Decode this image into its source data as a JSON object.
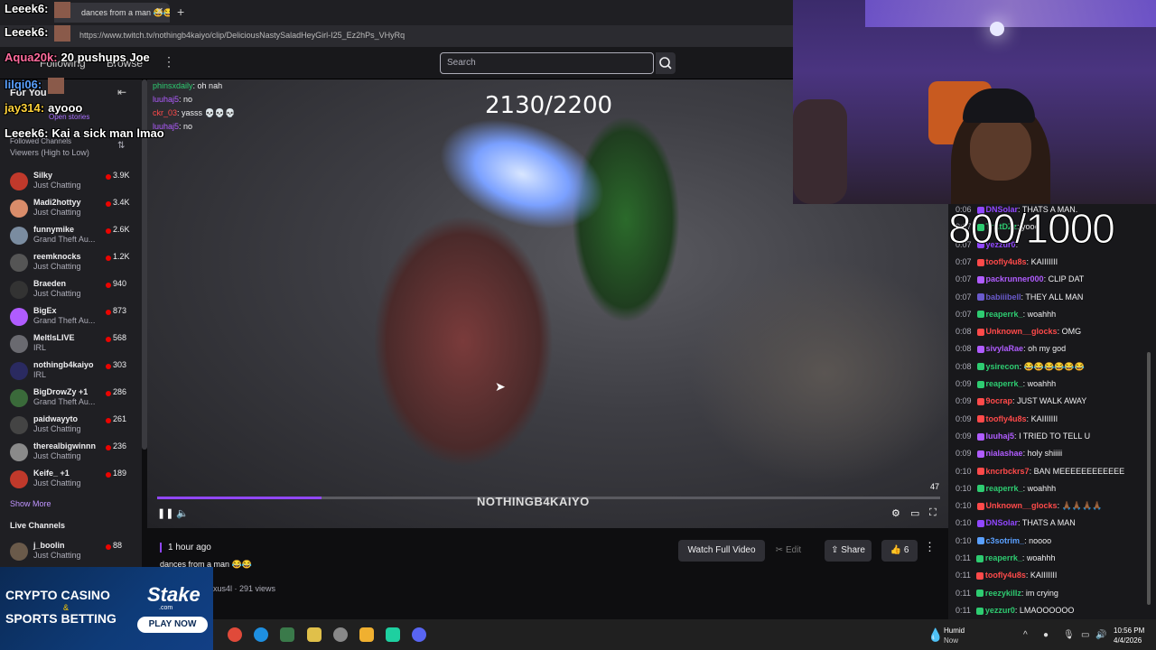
{
  "browser": {
    "tab_title": "dances from a man 😂😂",
    "url": "https://www.twitch.tv/nothingb4kaiyo/clip/DeliciousNastySaladHeyGirl-I25_Ez2hPs_VHyRq"
  },
  "nav": {
    "following": "Following",
    "browse": "Browse",
    "search_placeholder": "Search"
  },
  "sidebar": {
    "for_you": "For You",
    "open_stories": "Open stories",
    "followed": "Followed Channels",
    "sort": "Viewers (High to Low)",
    "channels": [
      {
        "name": "Silky",
        "category": "Just Chatting",
        "viewers": "3.9K",
        "color": "#c0392b"
      },
      {
        "name": "Madi2hottyy",
        "category": "Just Chatting",
        "viewers": "3.4K",
        "color": "#d98c6a"
      },
      {
        "name": "funnymike",
        "category": "Grand Theft Au...",
        "viewers": "2.6K",
        "color": "#7a8ca0"
      },
      {
        "name": "reemknocks",
        "category": "Just Chatting",
        "viewers": "1.2K",
        "color": "#555"
      },
      {
        "name": "Braeden",
        "category": "Just Chatting",
        "viewers": "940",
        "color": "#333"
      },
      {
        "name": "BigEx",
        "category": "Grand Theft Au...",
        "viewers": "873",
        "color": "#b05cff"
      },
      {
        "name": "MeltlsLIVE",
        "category": "IRL",
        "viewers": "568",
        "color": "#6a6a70"
      },
      {
        "name": "nothingb4kaiyo",
        "category": "IRL",
        "viewers": "303",
        "color": "#2a2a60"
      },
      {
        "name": "BigDrowZy +1",
        "category": "Grand Theft Au...",
        "viewers": "286",
        "color": "#3a6a3a"
      },
      {
        "name": "paidwayyto",
        "category": "Just Chatting",
        "viewers": "261",
        "color": "#444"
      },
      {
        "name": "therealbigwinnn",
        "category": "Just Chatting",
        "viewers": "236",
        "color": "#8a8a8a"
      },
      {
        "name": "Keife_ +1",
        "category": "Just Chatting",
        "viewers": "189",
        "color": "#c0392b"
      }
    ],
    "show_more": "Show More",
    "live_channels": "Live Channels",
    "live": [
      {
        "name": "j_boolin",
        "category": "Just Chatting",
        "viewers": "88",
        "color": "#6a5a4a"
      }
    ]
  },
  "player": {
    "video_chat": [
      {
        "user": "phinsxdaily",
        "text": "oh nah"
      },
      {
        "user": "luuhaj5",
        "text": "no"
      },
      {
        "user": "ckr_03",
        "text": "yasss 💀💀💀"
      },
      {
        "user": "luuhaj5",
        "text": "no"
      }
    ],
    "counter": "2130/2200",
    "time_remaining": "47",
    "watermark": "NOTHINGB4KAIYO",
    "progress": 0.21
  },
  "clip": {
    "age": "1 hour ago",
    "title": "dances from a man 😂😂",
    "meta": "xus4l · 291 views",
    "watch_full": "Watch Full Video",
    "edit": "Edit",
    "share": "Share",
    "likes": "6"
  },
  "overlay": {
    "lines": [
      {
        "user": "Leeek6:",
        "text": "",
        "color": "#ffffff",
        "img": true
      },
      {
        "user": "Leeek6:",
        "text": "",
        "color": "#ffffff",
        "img": true
      },
      {
        "user": "Aqua20k:",
        "text": "20 pushups Joe",
        "color": "#ff6b9d",
        "img": false
      },
      {
        "user": "lilqi06:",
        "text": "",
        "color": "#5aa0ff",
        "img": true
      },
      {
        "user": "jay314:",
        "text": "ayooo",
        "color": "#ffd23a",
        "img": false
      },
      {
        "user": "Leeek6:",
        "text": "Kai a sick man lmao",
        "color": "#ffffff",
        "img": false
      }
    ]
  },
  "chat": {
    "counter": "800/1000",
    "messages": [
      {
        "t": "0:06",
        "u": "DNSolar",
        "m": "THATS A MAN.",
        "c": "#9147ff"
      },
      {
        "t": "0:07",
        "u": "TrAtDZz",
        "m": "yooo",
        "c": "#2ecc71"
      },
      {
        "t": "0:07",
        "u": "yezzur0",
        "m": "",
        "c": "#9147ff"
      },
      {
        "t": "0:07",
        "u": "toofly4u8s",
        "m": "KAIIIIIII",
        "c": "#ff4a4a"
      },
      {
        "t": "0:07",
        "u": "packrunner000",
        "m": "CLIP DAT",
        "c": "#b05cff"
      },
      {
        "t": "0:07",
        "u": "babiiibell",
        "m": "THEY ALL MAN",
        "c": "#6a5acd"
      },
      {
        "t": "0:07",
        "u": "reaperrk_",
        "m": "woahhh",
        "c": "#2ecc71"
      },
      {
        "t": "0:08",
        "u": "Unknown__glocks",
        "m": "OMG",
        "c": "#ff4a4a"
      },
      {
        "t": "0:08",
        "u": "sivylaRae",
        "m": "oh my god",
        "c": "#b05cff"
      },
      {
        "t": "0:08",
        "u": "ysirecon",
        "m": "😂😂😂😂😂😂",
        "c": "#2ecc71"
      },
      {
        "t": "0:09",
        "u": "reaperrk_",
        "m": "woahhh",
        "c": "#2ecc71"
      },
      {
        "t": "0:09",
        "u": "9ocrap",
        "m": "JUST WALK AWAY",
        "c": "#ff4a4a"
      },
      {
        "t": "0:09",
        "u": "toofly4u8s",
        "m": "KAIIIIIII",
        "c": "#ff4a4a"
      },
      {
        "t": "0:09",
        "u": "luuhaj5",
        "m": "I TRIED TO TELL U",
        "c": "#b05cff"
      },
      {
        "t": "0:09",
        "u": "nialashae",
        "m": "holy shiiiii",
        "c": "#b05cff"
      },
      {
        "t": "0:10",
        "u": "kncrbckrs7",
        "m": "BAN MEEEEEEEEEEEE",
        "c": "#ff4a4a"
      },
      {
        "t": "0:10",
        "u": "reaperrk_",
        "m": "woahhh",
        "c": "#2ecc71"
      },
      {
        "t": "0:10",
        "u": "Unknown__glocks",
        "m": "🙏🏾🙏🏾🙏🏾🙏🏾",
        "c": "#ff4a4a"
      },
      {
        "t": "0:10",
        "u": "DNSolar",
        "m": "THATS A MAN",
        "c": "#9147ff"
      },
      {
        "t": "0:10",
        "u": "c3sotrim_",
        "m": "noooo",
        "c": "#5aa0ff"
      },
      {
        "t": "0:11",
        "u": "reaperrk_",
        "m": "woahhh",
        "c": "#2ecc71"
      },
      {
        "t": "0:11",
        "u": "toofly4u8s",
        "m": "KAIIIIIII",
        "c": "#ff4a4a"
      },
      {
        "t": "0:11",
        "u": "reezykillz",
        "m": "im crying",
        "c": "#2ecc71"
      },
      {
        "t": "0:11",
        "u": "yezzur0",
        "m": "LMAOOOOOO",
        "c": "#2ecc71"
      }
    ]
  },
  "ad": {
    "line1": "CRYPTO CASINO",
    "amp": "&",
    "line2": "SPORTS BETTING",
    "brand": "Stake",
    "brand_sub": ".com",
    "cta": "PLAY NOW"
  },
  "taskbar": {
    "weather_title": "Humid",
    "weather_sub": "Now",
    "time": "10:56 PM",
    "date": "4/4/2026"
  }
}
